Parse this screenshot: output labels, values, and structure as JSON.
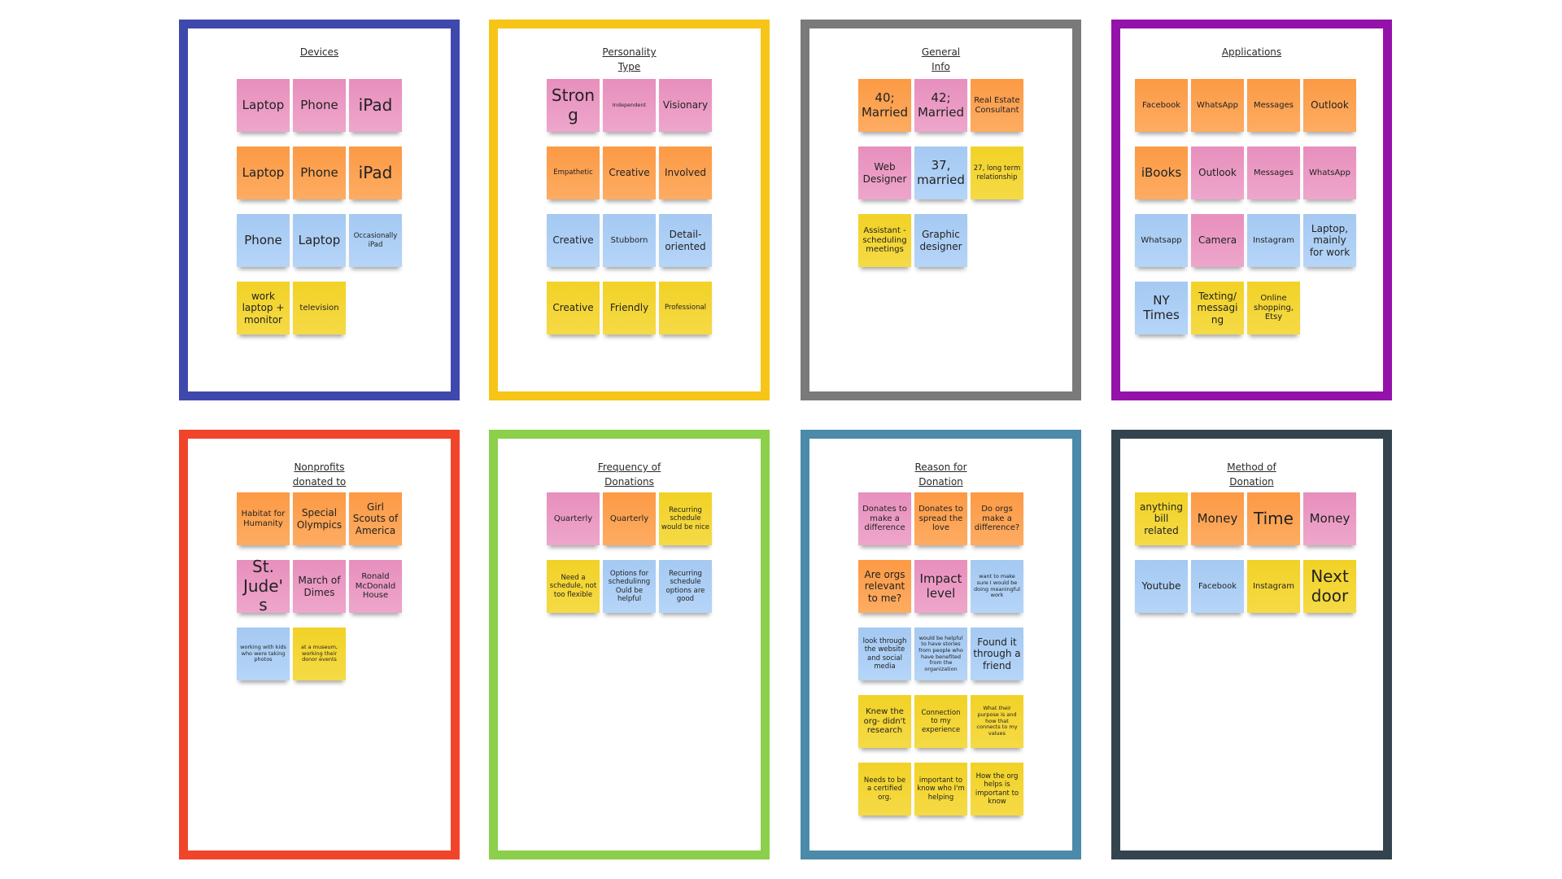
{
  "boards": [
    {
      "title": "Devices",
      "border_color": "#3f48ad",
      "notes": [
        {
          "text": "Laptop",
          "color": "pink",
          "size": "l"
        },
        {
          "text": "Phone",
          "color": "pink",
          "size": "l"
        },
        {
          "text": "iPad",
          "color": "pink",
          "size": "xl"
        },
        {
          "text": "Laptop",
          "color": "orange",
          "size": "l"
        },
        {
          "text": "Phone",
          "color": "orange",
          "size": "l"
        },
        {
          "text": "iPad",
          "color": "orange",
          "size": "xl"
        },
        {
          "text": "Phone",
          "color": "blue",
          "size": "l"
        },
        {
          "text": "Laptop",
          "color": "blue",
          "size": "l"
        },
        {
          "text": "Occasionally iPad",
          "color": "blue",
          "size": "xs"
        },
        {
          "text": "work laptop + monitor",
          "color": "yellow",
          "size": "m"
        },
        {
          "text": "television",
          "color": "yellow",
          "size": "s"
        }
      ]
    },
    {
      "title": "Personality\nType",
      "border_color": "#f6c518",
      "notes": [
        {
          "text": "Strong",
          "color": "pink",
          "size": "xl"
        },
        {
          "text": "Independent",
          "color": "pink",
          "size": "xxs"
        },
        {
          "text": "Visionary",
          "color": "pink",
          "size": "m"
        },
        {
          "text": "Empathetic",
          "color": "orange",
          "size": "xs"
        },
        {
          "text": "Creative",
          "color": "orange",
          "size": "m"
        },
        {
          "text": "Involved",
          "color": "orange",
          "size": "m"
        },
        {
          "text": "Creative",
          "color": "blue",
          "size": "m"
        },
        {
          "text": "Stubborn",
          "color": "blue",
          "size": "s"
        },
        {
          "text": "Detail-oriented",
          "color": "blue",
          "size": "m"
        },
        {
          "text": "Creative",
          "color": "yellow",
          "size": "m"
        },
        {
          "text": "Friendly",
          "color": "yellow",
          "size": "m"
        },
        {
          "text": "Professional",
          "color": "yellow",
          "size": "xs"
        }
      ]
    },
    {
      "title": "General\nInfo",
      "border_color": "#7a7a7a",
      "notes": [
        {
          "text": "40; Married",
          "color": "orange",
          "size": "l"
        },
        {
          "text": "42; Married",
          "color": "pink",
          "size": "l"
        },
        {
          "text": "Real Estate Consultant",
          "color": "orange",
          "size": "s"
        },
        {
          "text": "Web Designer",
          "color": "pink",
          "size": "m"
        },
        {
          "text": "37, married",
          "color": "blue",
          "size": "l"
        },
        {
          "text": "27, long term relationship",
          "color": "yellow",
          "size": "xs"
        },
        {
          "text": "Assistant - scheduling meetings",
          "color": "yellow",
          "size": "s"
        },
        {
          "text": "Graphic designer",
          "color": "blue",
          "size": "m"
        }
      ]
    },
    {
      "title": "Applications",
      "border_color": "#9412aa",
      "notes": [
        {
          "text": "Facebook",
          "color": "orange",
          "size": "s"
        },
        {
          "text": "WhatsApp",
          "color": "orange",
          "size": "s"
        },
        {
          "text": "Messages",
          "color": "orange",
          "size": "s"
        },
        {
          "text": "Outlook",
          "color": "orange",
          "size": "m"
        },
        {
          "text": "iBooks",
          "color": "orange",
          "size": "l"
        },
        {
          "text": "Outlook",
          "color": "pink",
          "size": "m"
        },
        {
          "text": "Messages",
          "color": "pink",
          "size": "s"
        },
        {
          "text": "WhatsApp",
          "color": "pink",
          "size": "s"
        },
        {
          "text": "Whatsapp",
          "color": "blue",
          "size": "s"
        },
        {
          "text": "Camera",
          "color": "pink",
          "size": "m"
        },
        {
          "text": "Instagram",
          "color": "blue",
          "size": "s"
        },
        {
          "text": "Laptop, mainly for work",
          "color": "blue",
          "size": "m"
        },
        {
          "text": "NY Times",
          "color": "blue",
          "size": "l"
        },
        {
          "text": "Texting/ messagi ng",
          "color": "yellow",
          "size": "m"
        },
        {
          "text": "Online shopping, Etsy",
          "color": "yellow",
          "size": "s"
        }
      ]
    },
    {
      "title": "Nonprofits\ndonated to",
      "border_color": "#f0452a",
      "notes": [
        {
          "text": "Habitat for Humanity",
          "color": "orange",
          "size": "s"
        },
        {
          "text": "Special Olympics",
          "color": "orange",
          "size": "m"
        },
        {
          "text": "Girl Scouts of America",
          "color": "orange",
          "size": "m"
        },
        {
          "text": "St. Jude's",
          "color": "pink",
          "size": "xl"
        },
        {
          "text": "March of Dimes",
          "color": "pink",
          "size": "m"
        },
        {
          "text": "Ronald McDonald House",
          "color": "pink",
          "size": "s"
        },
        {
          "text": "working with kids who were taking photos",
          "color": "blue",
          "size": "xxs"
        },
        {
          "text": "at a museum, working their donor events",
          "color": "yellow",
          "size": "xxs"
        }
      ]
    },
    {
      "title": "Frequency of\nDonations",
      "border_color": "#8bcf4a",
      "notes": [
        {
          "text": "Quarterly",
          "color": "pink",
          "size": "s"
        },
        {
          "text": "Quarterly",
          "color": "orange",
          "size": "s"
        },
        {
          "text": "Recurring schedule would be nice",
          "color": "yellow",
          "size": "xs"
        },
        {
          "text": "Need a schedule, not too flexible",
          "color": "yellow",
          "size": "xs"
        },
        {
          "text": "Options for schedulinng Ould be helpful",
          "color": "blue",
          "size": "xs"
        },
        {
          "text": "Recurring schedule options are good",
          "color": "blue",
          "size": "xs"
        }
      ]
    },
    {
      "title": "Reason for\nDonation",
      "border_color": "#4b8aa8",
      "notes": [
        {
          "text": "Donates to make a difference",
          "color": "pink",
          "size": "s"
        },
        {
          "text": "Donates to spread the love",
          "color": "orange",
          "size": "s"
        },
        {
          "text": "Do orgs make a difference?",
          "color": "orange",
          "size": "s"
        },
        {
          "text": "Are orgs relevant to me?",
          "color": "orange",
          "size": "m"
        },
        {
          "text": "Impact level",
          "color": "pink",
          "size": "l"
        },
        {
          "text": "want to make sure I would be doing meaningful work",
          "color": "blue",
          "size": "xxs"
        },
        {
          "text": "look through the website and social media",
          "color": "blue",
          "size": "xs"
        },
        {
          "text": "would be helpful to have stories from people who have benefited from the organization",
          "color": "blue",
          "size": "xxs"
        },
        {
          "text": "Found it through a friend",
          "color": "blue",
          "size": "m"
        },
        {
          "text": "Knew the org- didn't research",
          "color": "yellow",
          "size": "s"
        },
        {
          "text": "Connection to my experience",
          "color": "yellow",
          "size": "xs"
        },
        {
          "text": "What their purpose is and how that connects to my values",
          "color": "yellow",
          "size": "xxs"
        },
        {
          "text": "Needs to be a certified org.",
          "color": "yellow",
          "size": "xs"
        },
        {
          "text": "important to know who I'm helping",
          "color": "yellow",
          "size": "xs"
        },
        {
          "text": "How the org helps is important to know",
          "color": "yellow",
          "size": "xs"
        }
      ]
    },
    {
      "title": "Method of\nDonation",
      "border_color": "#34444f",
      "notes": [
        {
          "text": "anything bill related",
          "color": "yellow",
          "size": "m"
        },
        {
          "text": "Money",
          "color": "orange",
          "size": "l"
        },
        {
          "text": "Time",
          "color": "orange",
          "size": "xl"
        },
        {
          "text": "Money",
          "color": "pink",
          "size": "l"
        },
        {
          "text": "Youtube",
          "color": "blue",
          "size": "m"
        },
        {
          "text": "Facebook",
          "color": "blue",
          "size": "s"
        },
        {
          "text": "Instagram",
          "color": "yellow",
          "size": "s"
        },
        {
          "text": "Next door",
          "color": "yellow",
          "size": "xl"
        }
      ]
    }
  ]
}
